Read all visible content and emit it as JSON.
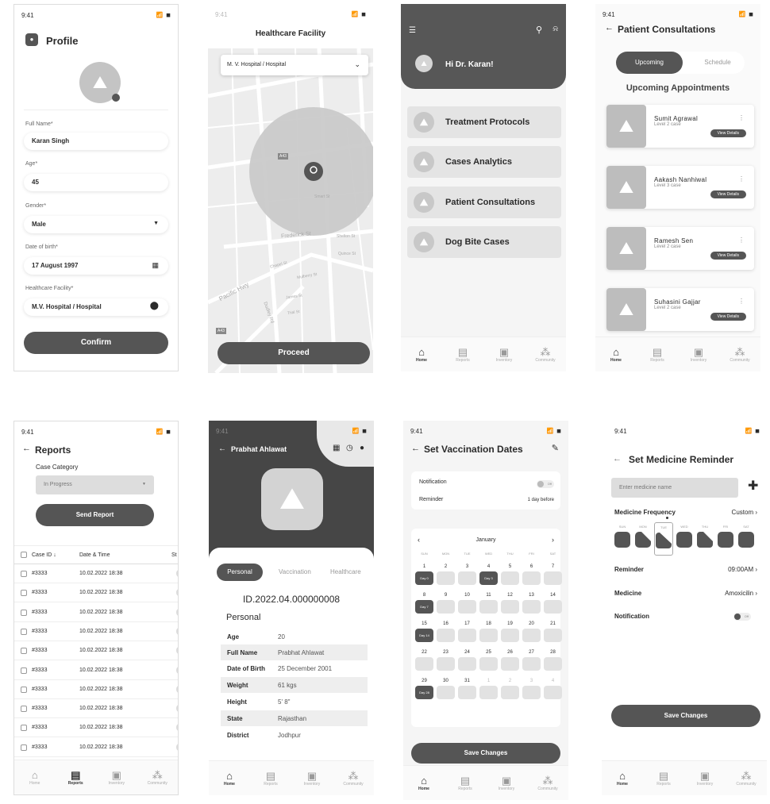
{
  "status_time": "9:41",
  "status_icons": "📶 ◼",
  "nav": {
    "home": "Home",
    "reports": "Reports",
    "inventory": "Inventory",
    "community": "Community"
  },
  "profile": {
    "title": "Profile",
    "fields": [
      {
        "label": "Full Name*",
        "value": "Karan Singh"
      },
      {
        "label": "Age*",
        "value": "45"
      },
      {
        "label": "Gender*",
        "value": "Male"
      },
      {
        "label": "Date of birth*",
        "value": "17 August 1997"
      },
      {
        "label": "Healthcare Facility*",
        "value": "M.V. Hospital / Hospital"
      }
    ],
    "confirm": "Confirm"
  },
  "facility": {
    "title": "Healthcare Facility",
    "select": "M. V. Hospital / Hospital",
    "proceed": "Proceed",
    "map_labels": {
      "a43": "A43",
      "a43b": "A43",
      "frederick": "Frederick St",
      "pacific": "Pacific Hwy",
      "dudley": "Dudley Rd",
      "smart": "Smart St",
      "chapel": "Chapel St",
      "mulberry": "Mulberry St",
      "james": "James St",
      "trial": "Trial St",
      "shelton": "Shelton St",
      "quince": "Quince St"
    }
  },
  "home": {
    "greeting": "Hi Dr. Karan!",
    "menu": [
      "Treatment Protocols",
      "Cases Analytics",
      "Patient Consultations",
      "Dog Bite Cases"
    ]
  },
  "consult": {
    "title": "Patient Consultations",
    "tabs": [
      "Upcoming",
      "Schedule"
    ],
    "heading": "Upcoming Appointments",
    "view": "View Details",
    "patients": [
      {
        "name": "Sumit Agrawal",
        "level": "Level 2 case"
      },
      {
        "name": "Aakash Nanhiwal",
        "level": "Level 3 case"
      },
      {
        "name": "Ramesh Sen",
        "level": "Level 2 case"
      },
      {
        "name": "Suhasini Gajjar",
        "level": "Level 2 case"
      }
    ]
  },
  "reports": {
    "title": "Reports",
    "category_label": "Case Category",
    "category_value": "In Progress",
    "send": "Send Report",
    "cols": [
      "Case ID ↓",
      "Date & Time",
      "St"
    ],
    "rows": [
      {
        "id": "#3333",
        "dt": "10.02.2022 18:38"
      },
      {
        "id": "#3333",
        "dt": "10.02.2022 18:38"
      },
      {
        "id": "#3333",
        "dt": "10.02.2022 18:38"
      },
      {
        "id": "#3333",
        "dt": "10.02.2022 18:38"
      },
      {
        "id": "#3333",
        "dt": "10.02.2022 18:38"
      },
      {
        "id": "#3333",
        "dt": "10.02.2022 18:38"
      },
      {
        "id": "#3333",
        "dt": "10.02.2022 18:38"
      },
      {
        "id": "#3333",
        "dt": "10.02.2022 18:38"
      },
      {
        "id": "#3333",
        "dt": "10.02.2022 18:38"
      },
      {
        "id": "#3333",
        "dt": "10.02.2022 18:38"
      }
    ]
  },
  "patient": {
    "name": "Prabhat Ahlawat",
    "tabs": [
      "Personal",
      "Vaccination",
      "Healthcare"
    ],
    "id": "ID.2022.04.000000008",
    "section": "Personal",
    "rows": [
      {
        "k": "Age",
        "v": "20"
      },
      {
        "k": "Full Name",
        "v": "Prabhat Ahlawat"
      },
      {
        "k": "Date of Birth",
        "v": "25 December 2001"
      },
      {
        "k": "Weight",
        "v": "61 kgs"
      },
      {
        "k": "Height",
        "v": "5' 8\""
      },
      {
        "k": "State",
        "v": "Rajasthan"
      },
      {
        "k": "District",
        "v": "Jodhpur"
      }
    ]
  },
  "vacc": {
    "title": "Set Vaccination Dates",
    "notification": "Notification",
    "off": "Off",
    "reminder": "Reminder",
    "reminder_val": "1 day before",
    "month": "January",
    "weekdays": [
      "SUN",
      "MON",
      "TUE",
      "WED",
      "THU",
      "FRI",
      "SAT"
    ],
    "days": [
      "1",
      "2",
      "3",
      "4",
      "5",
      "6",
      "7",
      "8",
      "9",
      "10",
      "11",
      "12",
      "13",
      "14",
      "15",
      "16",
      "17",
      "18",
      "19",
      "20",
      "21",
      "22",
      "23",
      "24",
      "25",
      "26",
      "27",
      "28",
      "29",
      "30",
      "31",
      "1",
      "2",
      "3",
      "4"
    ],
    "day_badges": {
      "0": "Day 0",
      "3": "Day 3",
      "7": "Day 7",
      "14": "Day 14",
      "28": "Day 28"
    },
    "save": "Save Changes"
  },
  "medicine": {
    "title": "Set Medicine Reminder",
    "placeholder": "Enter medicine name",
    "freq": "Medicine Frequency",
    "freq_val": "Custom ›",
    "weekdays": [
      "SUN",
      "MON",
      "TUE",
      "WED",
      "THU",
      "FRI",
      "SAT"
    ],
    "reminder": "Reminder",
    "reminder_val": "09:00AM ›",
    "medicine": "Medicine",
    "medicine_val": "Amoxicilin ›",
    "notification": "Notification",
    "off": "Off",
    "save": "Save Changes"
  }
}
